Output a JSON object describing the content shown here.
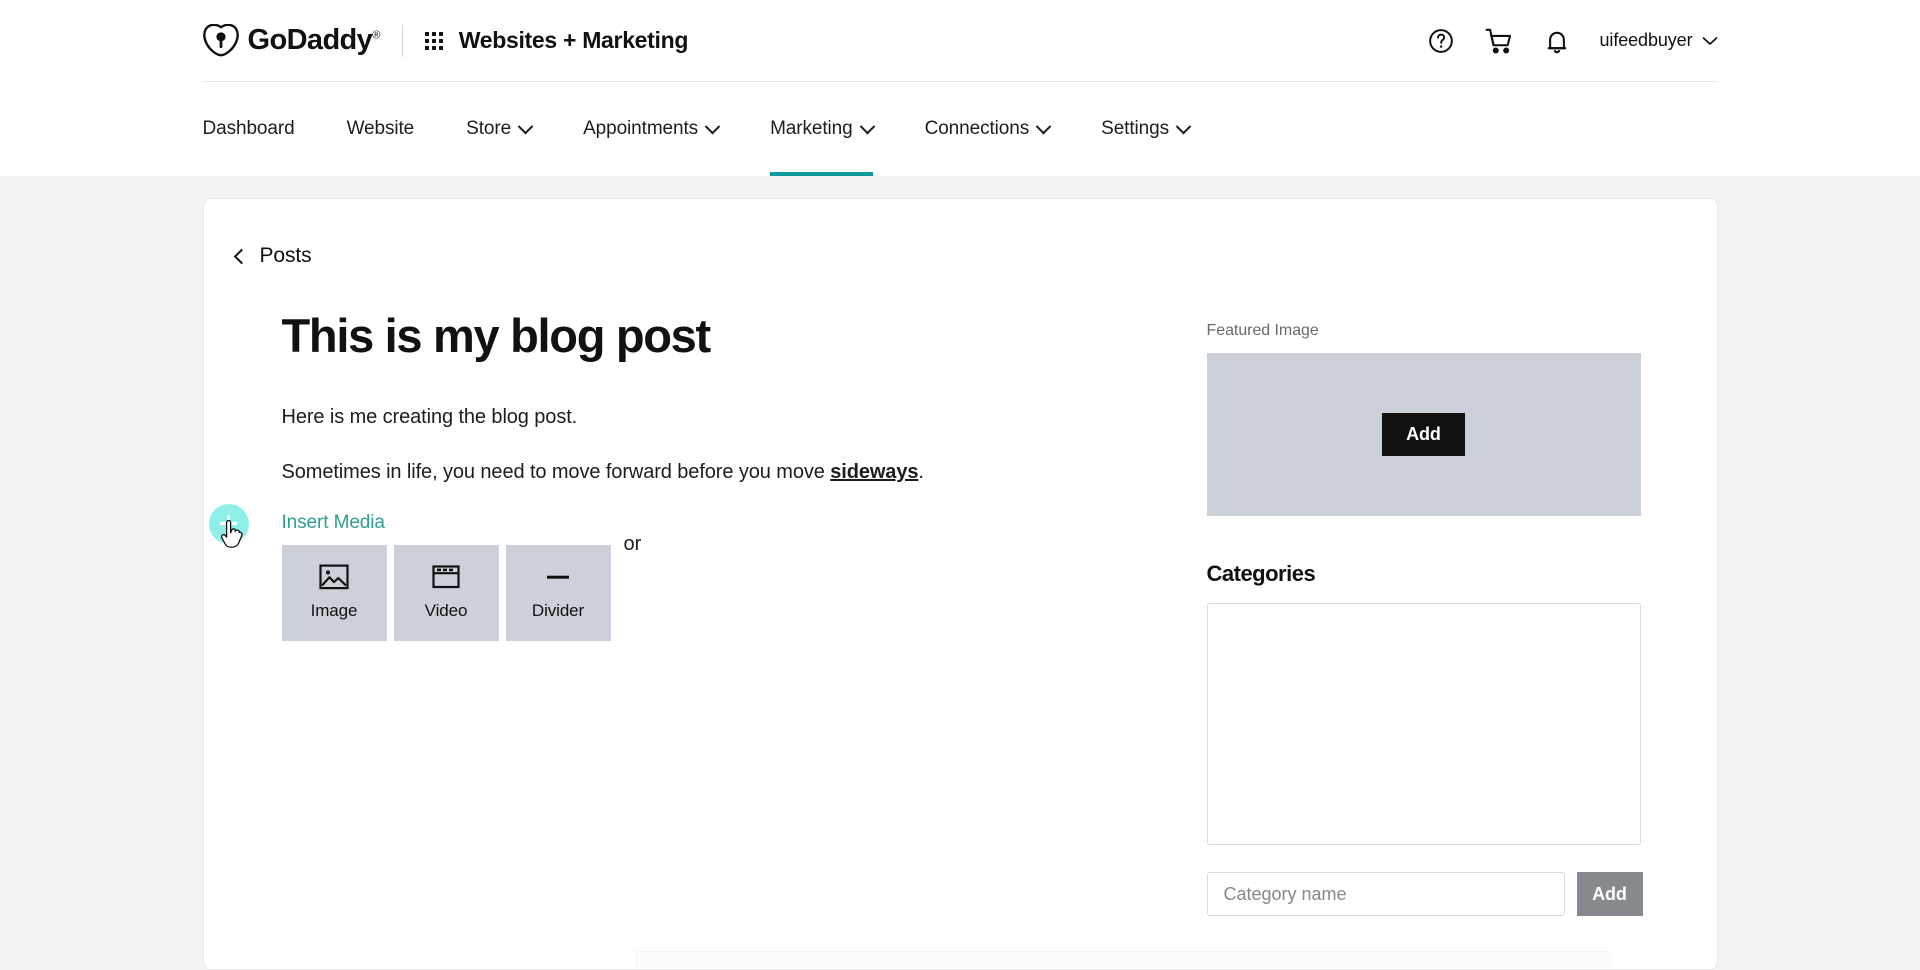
{
  "header": {
    "brand_name": "GoDaddy",
    "brand_tm": "®",
    "product_name": "Websites + Marketing",
    "help_icon": "question-circle-icon",
    "cart_icon": "shopping-cart-icon",
    "notifications_icon": "bell-icon",
    "account_name": "uifeedbuyer",
    "account_caret_icon": "chevron-down-icon",
    "apps_icon": "apps-grid-icon"
  },
  "nav": {
    "items": [
      {
        "label": "Dashboard",
        "has_caret": false,
        "active": false
      },
      {
        "label": "Website",
        "has_caret": false,
        "active": false
      },
      {
        "label": "Store",
        "has_caret": true,
        "active": false
      },
      {
        "label": "Appointments",
        "has_caret": true,
        "active": false
      },
      {
        "label": "Marketing",
        "has_caret": true,
        "active": true
      },
      {
        "label": "Connections",
        "has_caret": true,
        "active": false
      },
      {
        "label": "Settings",
        "has_caret": true,
        "active": false
      }
    ],
    "active_color": "#0f9b9b"
  },
  "breadcrumb": {
    "back_icon": "chevron-left-icon",
    "label": "Posts"
  },
  "post": {
    "title": "This is my blog post",
    "paragraph_1": "Here is me creating the blog post.",
    "paragraph_2_prefix": "Sometimes in life, you need to move forward before you move ",
    "paragraph_2_emphasis": "sideways",
    "paragraph_2_suffix": "."
  },
  "insert_media": {
    "label": "Insert Media",
    "label_color": "#2f9e8f",
    "or_text": "or",
    "add_block_icon": "plus-icon",
    "add_block_color": "#8ef0e8",
    "cursor_icon": "pointer-hand-cursor",
    "tiles": [
      {
        "label": "Image",
        "icon": "image-icon"
      },
      {
        "label": "Video",
        "icon": "video-window-icon"
      },
      {
        "label": "Divider",
        "icon": "horizontal-rule-icon"
      }
    ]
  },
  "sidebar": {
    "featured_image": {
      "label": "Featured Image",
      "add_button_label": "Add",
      "placeholder_color": "#ccd1d9"
    },
    "categories": {
      "heading": "Categories",
      "list_items": [],
      "input_placeholder": "Category name",
      "input_value": "",
      "add_button_label": "Add",
      "add_button_disabled": true
    }
  }
}
